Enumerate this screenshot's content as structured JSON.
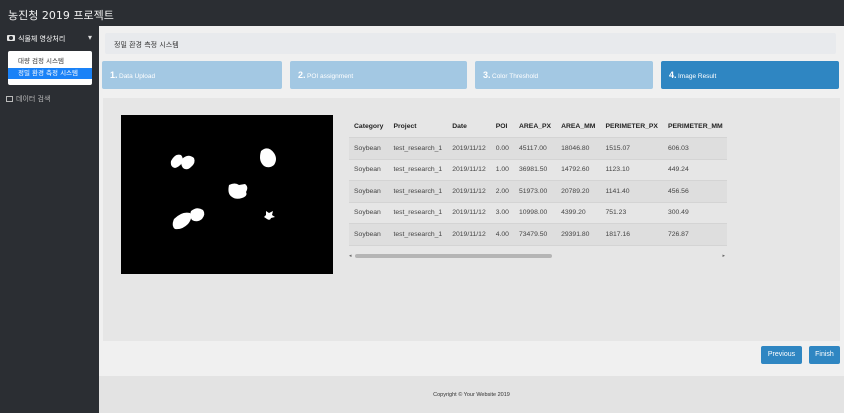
{
  "app": {
    "title": "농진청 2019 프로젝트"
  },
  "sidebar": {
    "header": {
      "icon": "camera-icon",
      "label": "식물체 영상처리",
      "chevron": "▾"
    },
    "submenu": [
      {
        "label": "대량 검정 시스템",
        "active": false
      },
      {
        "label": "정밀 환경 측정 시스템",
        "active": true
      }
    ],
    "search": {
      "icon": "table-icon",
      "label": "데이터 검색"
    }
  },
  "breadcrumb": {
    "title": "정밀 환경 측정 시스템"
  },
  "steps": [
    {
      "num": "1.",
      "label": "Data Upload",
      "active": false
    },
    {
      "num": "2.",
      "label": "POI assignment",
      "active": false
    },
    {
      "num": "3.",
      "label": "Color Threshold",
      "active": false
    },
    {
      "num": "4.",
      "label": "Image Result",
      "active": true
    }
  ],
  "result_table": {
    "columns": [
      "Category",
      "Project",
      "Date",
      "POI",
      "AREA_PX",
      "AREA_MM",
      "PERIMETER_PX",
      "PERIMETER_MM"
    ],
    "rows": [
      [
        "Soybean",
        "test_research_1",
        "2019/11/12",
        "0.00",
        "45117.00",
        "18046.80",
        "1515.07",
        "606.03"
      ],
      [
        "Soybean",
        "test_research_1",
        "2019/11/12",
        "1.00",
        "36981.50",
        "14792.60",
        "1123.10",
        "449.24"
      ],
      [
        "Soybean",
        "test_research_1",
        "2019/11/12",
        "2.00",
        "51973.00",
        "20789.20",
        "1141.40",
        "456.56"
      ],
      [
        "Soybean",
        "test_research_1",
        "2019/11/12",
        "3.00",
        "10998.00",
        "4399.20",
        "751.23",
        "300.49"
      ],
      [
        "Soybean",
        "test_research_1",
        "2019/11/12",
        "4.00",
        "73479.50",
        "29391.80",
        "1817.16",
        "726.87"
      ]
    ]
  },
  "buttons": {
    "previous": "Previous",
    "finish": "Finish"
  },
  "footer": {
    "copyright": "Copyright © Your Website 2019"
  },
  "colors": {
    "topbar": "#2b2e33",
    "step_inactive": "#a3c8e3",
    "step_active": "#2f86c2",
    "accent": "#1a82f7"
  }
}
